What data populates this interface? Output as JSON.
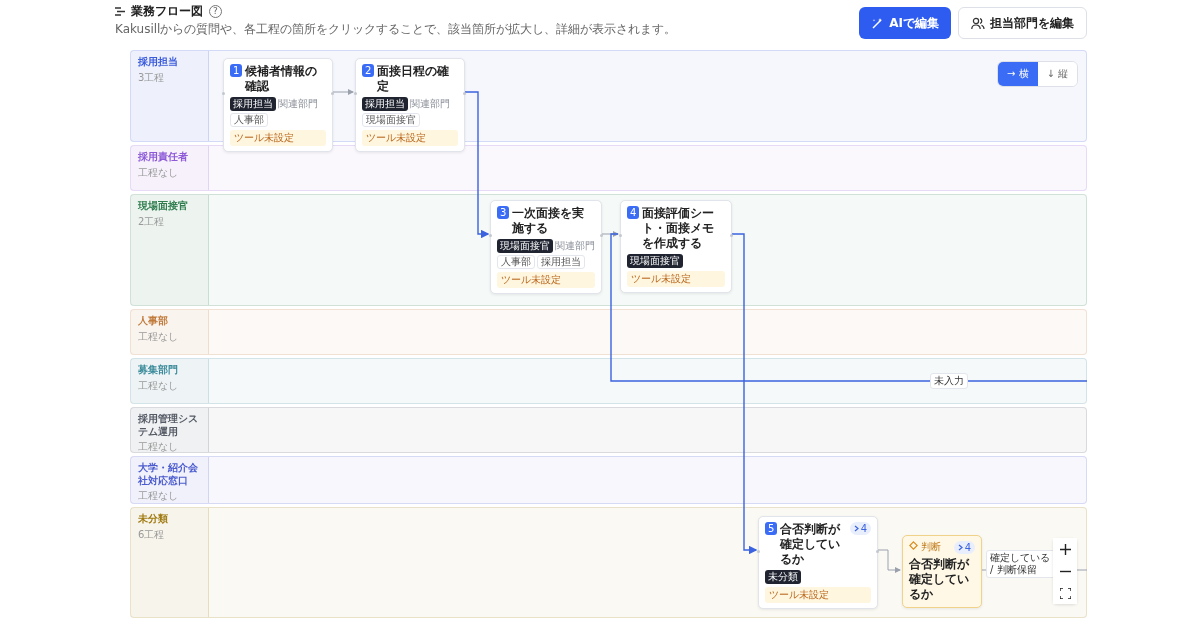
{
  "header": {
    "title": "業務フロー図",
    "help": "?",
    "subtitle": "Kakusillからの質問や、各工程の箇所をクリックすることで、該当箇所が拡大し、詳細が表示されます。",
    "buttons": [
      {
        "kind": "ai",
        "label": "AIで編集"
      },
      {
        "kind": "people",
        "label": "担当部門を編集"
      }
    ]
  },
  "lanes": [
    {
      "name": "採用担当",
      "count": "3工程",
      "color": "#3b5bdb"
    },
    {
      "name": "採用責任者",
      "count": "工程なし",
      "color": "#8e5ad8"
    },
    {
      "name": "現場面接官",
      "count": "2工程",
      "color": "#2f7d4f"
    },
    {
      "name": "人事部",
      "count": "工程なし",
      "color": "#c07a3a"
    },
    {
      "name": "募集部門",
      "count": "工程なし",
      "color": "#3a8a9a"
    },
    {
      "name": "採用管理システム運用",
      "count": "工程なし",
      "color": "#555b66"
    },
    {
      "name": "大学・紹介会社対応窓口",
      "count": "工程なし",
      "color": "#4c5ccf"
    },
    {
      "name": "未分類",
      "count": "6工程",
      "color": "#a07a10"
    }
  ],
  "orientation_toggle": [
    {
      "label": "→ 横",
      "selected": true
    },
    {
      "label": "↓ 縦",
      "selected": false
    }
  ],
  "nodes": [
    {
      "kind": "task",
      "number": "1",
      "title": "候補者情報の確認",
      "owner": "採用担当",
      "related_label": "関連部門",
      "related": [
        "人事部"
      ],
      "tool": "ツール未設定"
    },
    {
      "kind": "task",
      "number": "2",
      "title": "面接日程の確定",
      "owner": "採用担当",
      "related_label": "関連部門",
      "related": [
        "現場面接官"
      ],
      "tool": "ツール未設定"
    },
    {
      "kind": "task",
      "number": "3",
      "title": "一次面接を実施する",
      "owner": "現場面接官",
      "related_label": "関連部門",
      "related": [
        "人事部",
        "採用担当"
      ],
      "tool": "ツール未設定"
    },
    {
      "kind": "task",
      "number": "4",
      "title": "面接評価シート・面接メモを作成する",
      "owner": "現場面接官",
      "tool": "ツール未設定"
    },
    {
      "kind": "task",
      "number": "5",
      "title": "合否判断が確定しているか",
      "count": "4",
      "owner": "未分類",
      "tool": "ツール未設定"
    },
    {
      "kind": "decision",
      "label": "判断",
      "count": "4",
      "title": "合否判断が確定しているか"
    }
  ],
  "edges": [
    {
      "kind": "secondary"
    },
    {
      "kind": "primary"
    },
    {
      "kind": "secondary"
    },
    {
      "kind": "primary"
    },
    {
      "kind": "primary",
      "label": "未入力"
    },
    {
      "kind": "secondary"
    },
    {
      "kind": "secondary",
      "label": "確定している / 判断保留"
    }
  ]
}
